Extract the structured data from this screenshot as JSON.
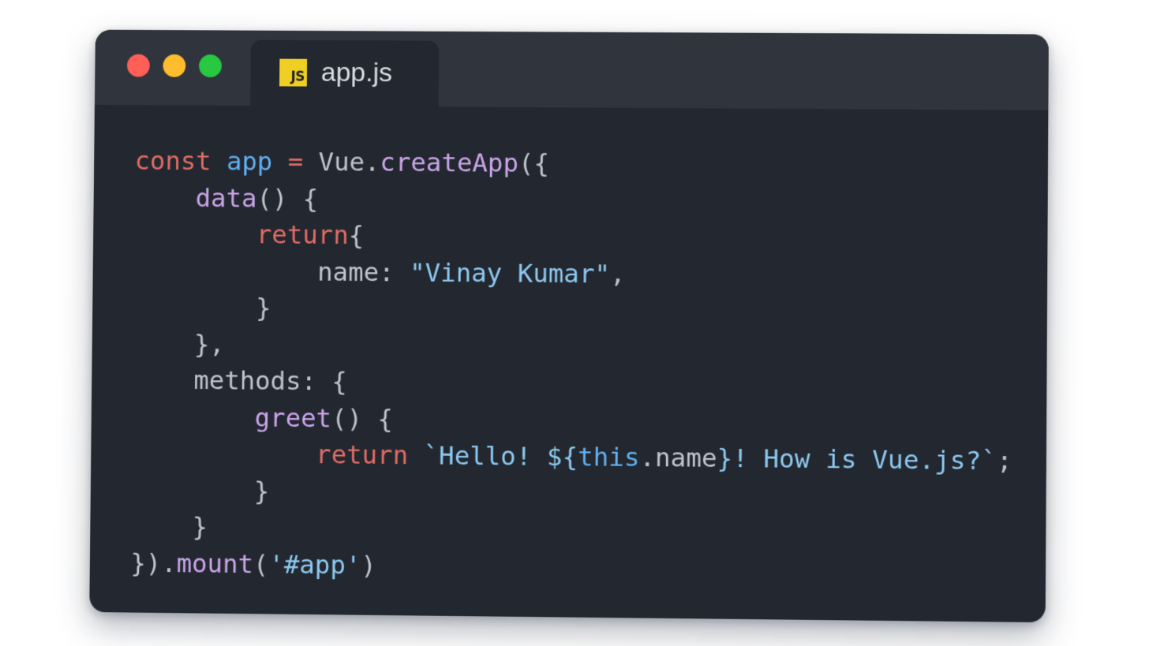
{
  "window": {
    "traffic_lights": [
      {
        "name": "close",
        "color": "#ff5f57"
      },
      {
        "name": "minimize",
        "color": "#febc2e"
      },
      {
        "name": "maximize",
        "color": "#28c840"
      }
    ]
  },
  "tab": {
    "icon": "javascript-file-icon",
    "icon_text": "JS",
    "title": "app.js"
  },
  "code": {
    "language": "javascript",
    "lines": [
      [
        [
          "kw",
          "const "
        ],
        [
          "var",
          "app "
        ],
        [
          "op",
          "= "
        ],
        [
          "plain",
          "Vue."
        ],
        [
          "fn",
          "createApp"
        ],
        [
          "plain",
          "({"
        ]
      ],
      [
        [
          "plain",
          "    "
        ],
        [
          "fn",
          "data"
        ],
        [
          "plain",
          "() {"
        ]
      ],
      [
        [
          "plain",
          "        "
        ],
        [
          "kw",
          "return"
        ],
        [
          "plain",
          "{"
        ]
      ],
      [
        [
          "plain",
          "            name: "
        ],
        [
          "str",
          "\"Vinay Kumar\""
        ],
        [
          "plain",
          ","
        ]
      ],
      [
        [
          "plain",
          "        }"
        ]
      ],
      [
        [
          "plain",
          "    },"
        ]
      ],
      [
        [
          "plain",
          "    methods: {"
        ]
      ],
      [
        [
          "plain",
          "        "
        ],
        [
          "fn",
          "greet"
        ],
        [
          "plain",
          "() {"
        ]
      ],
      [
        [
          "plain",
          "            "
        ],
        [
          "kw",
          "return "
        ],
        [
          "str",
          "`Hello! ${"
        ],
        [
          "var",
          "this"
        ],
        [
          "plain",
          ".name"
        ],
        [
          "str",
          "}! How is Vue.js?`"
        ],
        [
          "plain",
          ";"
        ]
      ],
      [
        [
          "plain",
          "        }"
        ]
      ],
      [
        [
          "plain",
          "    }"
        ]
      ],
      [
        [
          "plain",
          "})."
        ],
        [
          "fn",
          "mount"
        ],
        [
          "plain",
          "("
        ],
        [
          "str",
          "'#app'"
        ],
        [
          "plain",
          ")"
        ]
      ]
    ]
  }
}
